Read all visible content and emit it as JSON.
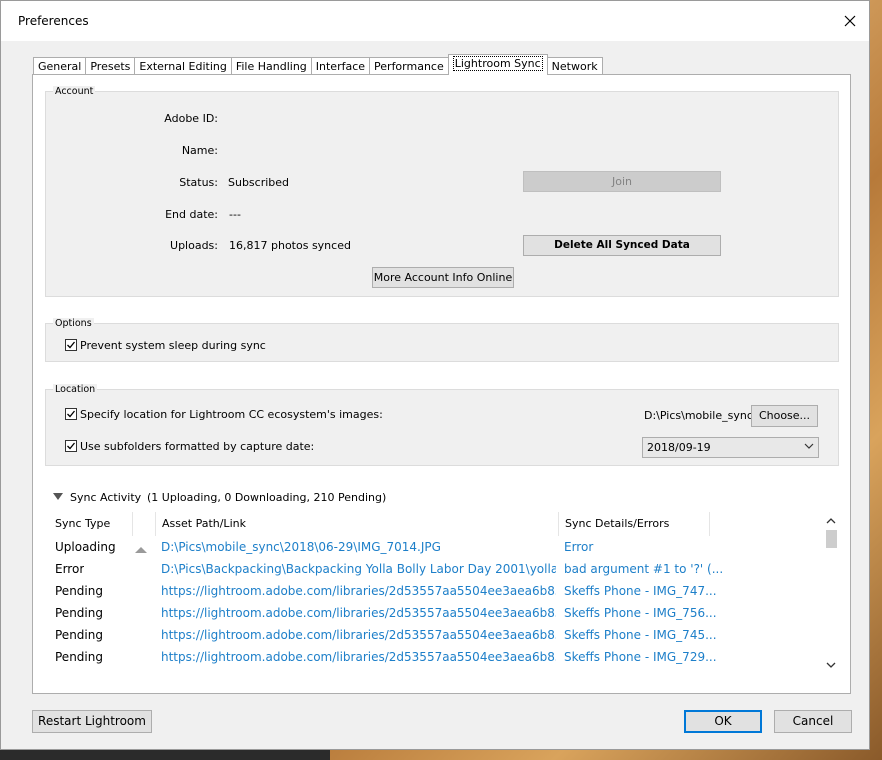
{
  "window": {
    "title": "Preferences"
  },
  "tabs": [
    "General",
    "Presets",
    "External Editing",
    "File Handling",
    "Interface",
    "Performance",
    "Lightroom Sync",
    "Network"
  ],
  "account": {
    "legend": "Account",
    "adobe_id_label": "Adobe ID:",
    "adobe_id_value": "",
    "name_label": "Name:",
    "name_value": "",
    "status_label": "Status:",
    "status_value": "Subscribed",
    "end_date_label": "End date:",
    "end_date_value": "---",
    "uploads_label": "Uploads:",
    "uploads_value": "16,817 photos synced",
    "join_button": "Join",
    "delete_button": "Delete All Synced Data",
    "more_info_button": "More Account Info Online"
  },
  "options": {
    "legend": "Options",
    "prevent_sleep_label": "Prevent system sleep during sync",
    "prevent_sleep_checked": true
  },
  "location": {
    "legend": "Location",
    "specify_label": "Specify location for Lightroom CC ecosystem's images:",
    "specify_checked": true,
    "path": "D:\\Pics\\mobile_sync",
    "choose_button": "Choose...",
    "subfolders_label": "Use subfolders formatted by capture date:",
    "subfolders_checked": true,
    "date_format": "2018/09-19"
  },
  "sync_activity": {
    "title": "Sync Activity",
    "summary": "(1 Uploading, 0 Downloading, 210 Pending)",
    "columns": [
      "Sync Type",
      "Asset Path/Link",
      "Sync Details/Errors"
    ],
    "rows": [
      {
        "type": "Uploading",
        "path": "D:\\Pics\\mobile_sync\\2018\\06-29\\IMG_7014.JPG",
        "details": "Error"
      },
      {
        "type": "Error",
        "path": "D:\\Pics\\Backpacking\\Backpacking Yolla Bolly Labor Day 2001\\yolla_...",
        "details": "bad argument #1 to '?' (..."
      },
      {
        "type": "Pending",
        "path": "https://lightroom.adobe.com/libraries/2d53557aa5504ee3aea6b85...",
        "details": "Skeffs Phone  - IMG_747..."
      },
      {
        "type": "Pending",
        "path": "https://lightroom.adobe.com/libraries/2d53557aa5504ee3aea6b85...",
        "details": "Skeffs Phone  - IMG_756..."
      },
      {
        "type": "Pending",
        "path": "https://lightroom.adobe.com/libraries/2d53557aa5504ee3aea6b85...",
        "details": "Skeffs Phone  - IMG_745..."
      },
      {
        "type": "Pending",
        "path": "https://lightroom.adobe.com/libraries/2d53557aa5504ee3aea6b85...",
        "details": "Skeffs Phone  - IMG_729..."
      }
    ]
  },
  "footer": {
    "restart_button": "Restart Lightroom",
    "ok_button": "OK",
    "cancel_button": "Cancel"
  },
  "colors": {
    "link": "#1d7fc9",
    "window_bg": "#f0f0f0",
    "ok_border": "#0078d7"
  },
  "icons": {
    "close": "close-icon",
    "checkbox": "checkmark-icon",
    "dropdown": "chevron-down-icon",
    "collapse": "triangle-down-icon"
  }
}
